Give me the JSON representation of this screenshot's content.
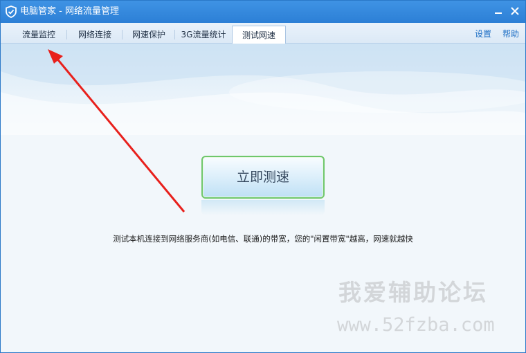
{
  "window": {
    "title": "电脑管家 - 网络流量管理"
  },
  "tabs": [
    {
      "label": "流量监控"
    },
    {
      "label": "网络连接"
    },
    {
      "label": "网速保护"
    },
    {
      "label": "3G流量统计"
    },
    {
      "label": "测试网速"
    }
  ],
  "active_tab": "测试网速",
  "header_links": {
    "settings": "设置",
    "help": "帮助"
  },
  "main": {
    "speed_test_button": "立即测速",
    "description": "测试本机连接到网络服务商(如电信、联通)的带宽，您的\"闲置带宽\"越高，网速就越快"
  },
  "watermark": {
    "title": "我爱辅助论坛",
    "url": "www.52fzba.com"
  },
  "colors": {
    "titlebar": "#2c7fd6",
    "button_border": "#6fc76b",
    "link": "#1f6fc5",
    "annotation_arrow": "#e8201c"
  },
  "icons": {
    "app_logo": "shield-check-icon",
    "minimize": "minimize-icon",
    "close": "close-icon"
  }
}
